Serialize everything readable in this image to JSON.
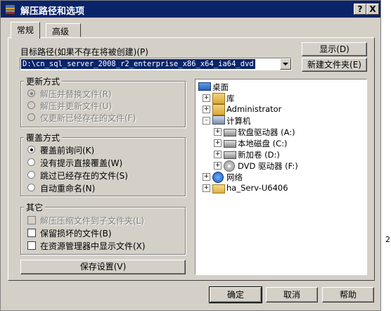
{
  "window": {
    "title": "解压路径和选项",
    "help_btn": "?",
    "close_btn": "X",
    "colors": {
      "titlebar": "#0a246a",
      "face": "#d4d0c8",
      "selection": "#0a246a"
    }
  },
  "tabs": [
    {
      "label": "常规",
      "active": true
    },
    {
      "label": "高级",
      "active": false
    }
  ],
  "target": {
    "label": "目标路径(如果不存在将被创建)(P)",
    "value": "D:\\cn_sql_server_2008_r2_enterprise_x86_x64_ia64_dvd"
  },
  "buttons": {
    "show": "显示(D)",
    "new_folder": "新建文件夹(E)",
    "save_settings": "保存设置(V)",
    "ok": "确定",
    "cancel": "取消",
    "help": "帮助"
  },
  "update_mode": {
    "title": "更新方式",
    "options": [
      {
        "label": "解压并替换文件(R)",
        "checked": true,
        "disabled": true
      },
      {
        "label": "解压并更新文件(U)",
        "checked": false,
        "disabled": true
      },
      {
        "label": "仅更新已经存在的文件(F)",
        "checked": false,
        "disabled": true
      }
    ]
  },
  "overwrite_mode": {
    "title": "覆盖方式",
    "options": [
      {
        "label": "覆盖前询问(K)",
        "checked": true
      },
      {
        "label": "没有提示直接覆盖(W)",
        "checked": false
      },
      {
        "label": "跳过已经存在的文件(S)",
        "checked": false
      },
      {
        "label": "自动重命名(N)",
        "checked": false
      }
    ]
  },
  "misc": {
    "title": "其它",
    "options": [
      {
        "label": "解压压缩文件到子文件夹(L)",
        "checked": false,
        "disabled": true
      },
      {
        "label": "保留损坏的文件(B)",
        "checked": false,
        "disabled": false
      },
      {
        "label": "在资源管理器中显示文件(X)",
        "checked": false,
        "disabled": false
      }
    ]
  },
  "tree": {
    "nodes": [
      {
        "label": "桌面",
        "level": 0,
        "expander": "",
        "icon": "desktop-icon"
      },
      {
        "label": "库",
        "level": 1,
        "expander": "+",
        "icon": "library-icon"
      },
      {
        "label": "Administrator",
        "level": 1,
        "expander": "+",
        "icon": "user-folder-icon"
      },
      {
        "label": "计算机",
        "level": 1,
        "expander": "-",
        "icon": "computer-icon"
      },
      {
        "label": "软盘驱动器 (A:)",
        "level": 2,
        "expander": "+",
        "icon": "floppy-drive-icon"
      },
      {
        "label": "本地磁盘 (C:)",
        "level": 2,
        "expander": "+",
        "icon": "system-disk-icon"
      },
      {
        "label": "新加卷 (D:)",
        "level": 2,
        "expander": "+",
        "icon": "disk-icon"
      },
      {
        "label": "DVD 驱动器 (F:)",
        "level": 2,
        "expander": "+",
        "icon": "dvd-drive-icon"
      },
      {
        "label": "网络",
        "level": 1,
        "expander": "+",
        "icon": "network-icon"
      },
      {
        "label": "ha_Serv-U6406",
        "level": 1,
        "expander": "+",
        "icon": "folder-icon"
      }
    ]
  },
  "background": {
    "edge_text": "2"
  }
}
